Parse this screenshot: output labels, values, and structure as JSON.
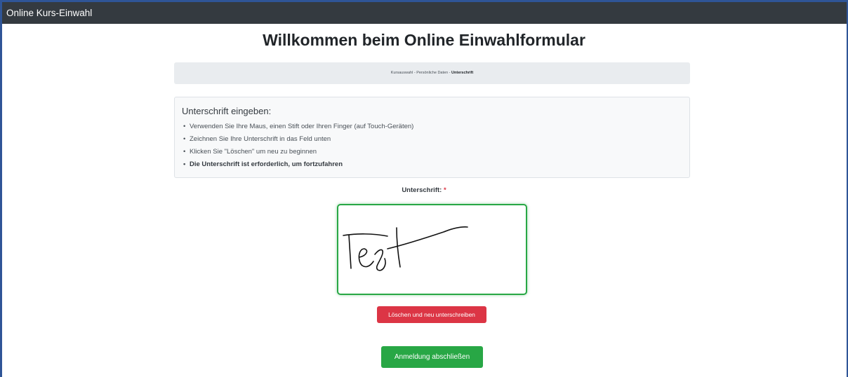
{
  "window": {
    "title": "Online Kurs-Einwahl"
  },
  "header": {
    "title": "Willkommen beim Online Einwahlformular"
  },
  "breadcrumb": {
    "step1": "Kursauswahl",
    "sep1": " - ",
    "step2": "Persönliche Daten",
    "sep2": " - ",
    "step3": "Unterschrift"
  },
  "instructions": {
    "title": "Unterschrift eingeben:",
    "items": [
      "Verwenden Sie Ihre Maus, einen Stift oder Ihren Finger (auf Touch-Geräten)",
      "Zeichnen Sie Ihre Unterschrift in das Feld unten",
      "Klicken Sie \"Löschen\" um neu zu beginnen",
      "Die Unterschrift ist erforderlich, um fortzufahren"
    ]
  },
  "signature": {
    "label": "Unterschrift:",
    "required_mark": "*"
  },
  "buttons": {
    "clear": "Löschen und neu unterschreiben",
    "submit": "Anmeldung abschließen"
  },
  "colors": {
    "titlebar": "#343a40",
    "danger": "#dc3545",
    "success": "#28a745",
    "breadcrumb_bg": "#e9ecef",
    "frame": "#2f5597"
  }
}
